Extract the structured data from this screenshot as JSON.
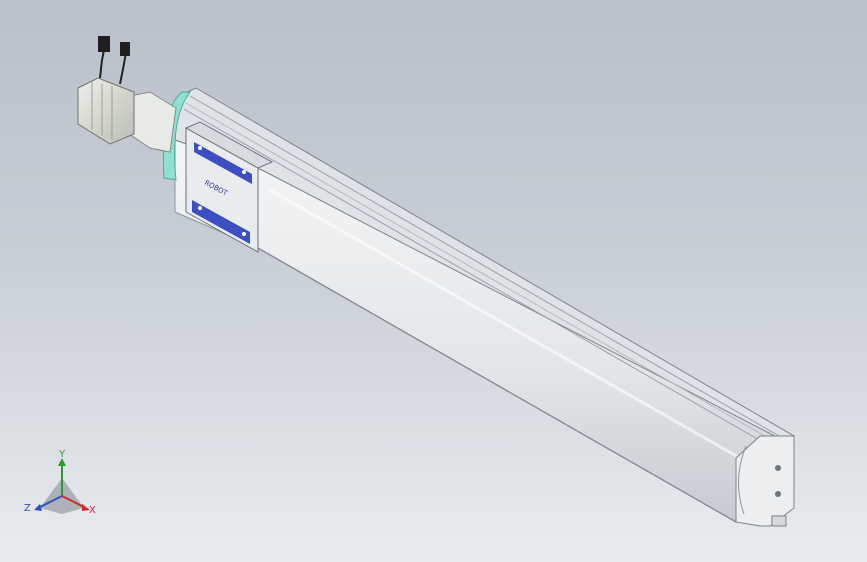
{
  "viewport": {
    "background_top": "#b9c0ca",
    "background_bottom": "#e9ecef"
  },
  "model": {
    "actuator_body_color": "#e6e9ec",
    "actuator_shadow_color": "#c9ced4",
    "carriage_accent_color": "#3d4fc0",
    "coupler_ring_color": "#7fd8c8",
    "motor_color": "#d9dcd4",
    "carriage_logo_text": "ROBOT"
  },
  "triad": {
    "y_label": "Y",
    "z_label": "Z",
    "x_label": "X",
    "y_color": "#2c9a2c",
    "z_color": "#2d4fc4",
    "x_color": "#cf2b2b"
  }
}
